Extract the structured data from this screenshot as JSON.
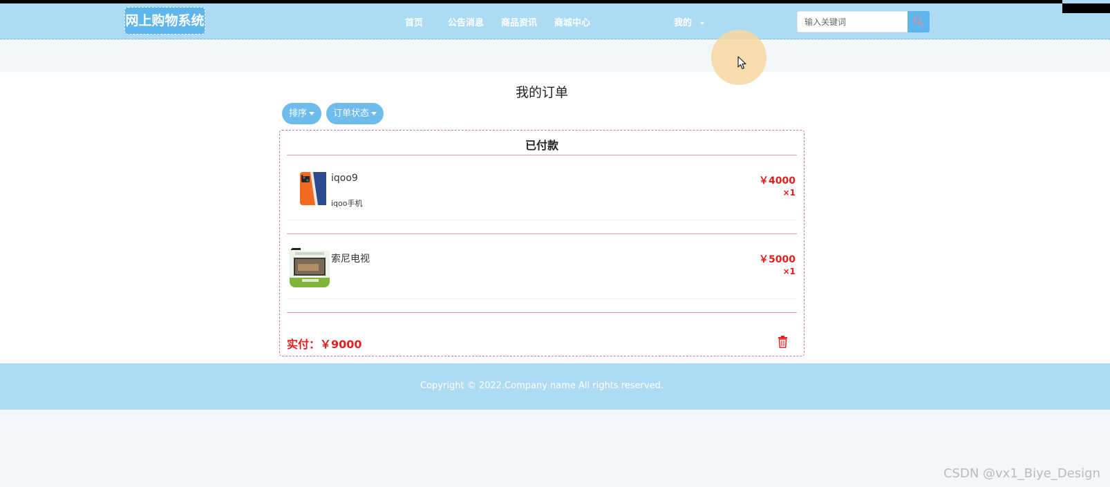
{
  "header": {
    "logo": "网上购物系统",
    "nav": {
      "home": "首页",
      "notices": "公告消息",
      "product_news": "商品资讯",
      "mall_center": "商城中心",
      "mine": "我的"
    },
    "search": {
      "placeholder": "输入关键词",
      "icon": "search-icon"
    }
  },
  "main": {
    "title": "我的订单",
    "filters": {
      "sort": "排序",
      "order_status": "订单状态"
    },
    "order": {
      "status": "已付款",
      "items": [
        {
          "name": "iqoo9",
          "description": "iqoo手机",
          "price": "￥4000",
          "quantity": "×1",
          "image": "phone-image"
        },
        {
          "name": "索尼电视",
          "description": "",
          "price": "￥5000",
          "quantity": "×1",
          "image": "tv-image"
        }
      ],
      "total": "实付：￥9000",
      "delete_icon": "trash-icon"
    }
  },
  "footer": {
    "copyright": "Copyright © 2022.Company name All rights reserved."
  },
  "watermark": "CSDN @vx1_Biye_Design",
  "colors": {
    "header_bg": "#aedbf4",
    "accent": "#5eb6ec",
    "price_red": "#e02020",
    "card_border": "#d47a88"
  }
}
